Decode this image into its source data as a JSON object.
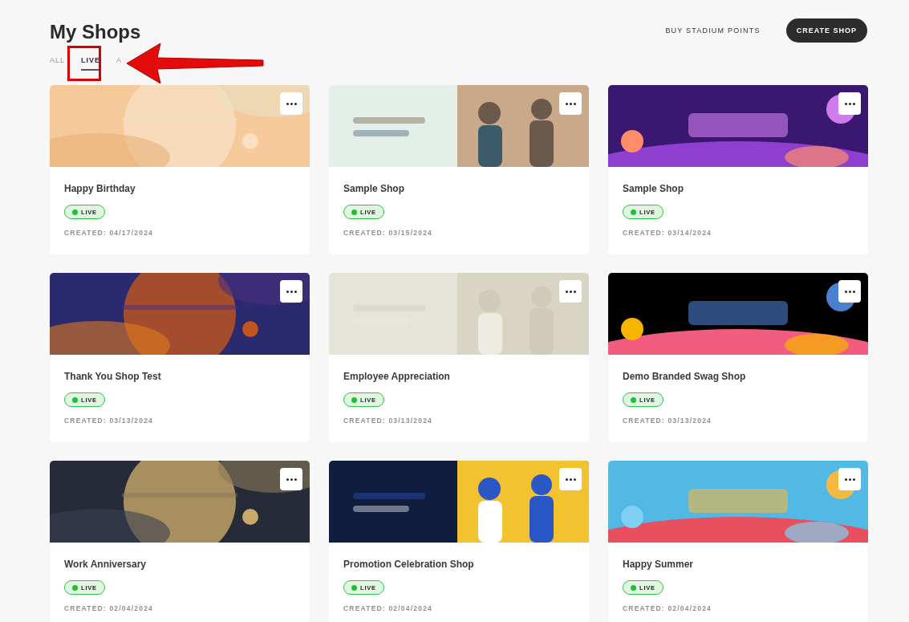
{
  "page": {
    "title": "My Shops"
  },
  "actions": [
    {
      "kind": "link",
      "label": "BUY STADIUM POINTS"
    },
    {
      "kind": "primary",
      "label": "CREATE SHOP"
    }
  ],
  "tabs": [
    {
      "label": "ALL",
      "selected": false
    },
    {
      "label": "LIVE",
      "selected": true
    },
    {
      "label": "A",
      "selected": false
    }
  ],
  "shops": [
    {
      "name": "Happy Birthday",
      "status": "LIVE",
      "created": "CREATED: 04/17/2024"
    },
    {
      "name": "Sample Shop",
      "status": "LIVE",
      "created": "CREATED: 03/15/2024"
    },
    {
      "name": "Sample Shop",
      "status": "LIVE",
      "created": "CREATED: 03/14/2024"
    },
    {
      "name": "Thank You Shop Test",
      "status": "LIVE",
      "created": "CREATED: 03/13/2024"
    },
    {
      "name": "Employee Appreciation",
      "status": "LIVE",
      "created": "CREATED: 03/13/2024"
    },
    {
      "name": "Demo Branded Swag Shop",
      "status": "LIVE",
      "created": "CREATED: 03/13/2024"
    },
    {
      "name": "Work Anniversary",
      "status": "LIVE",
      "created": "CREATED: 02/04/2024"
    },
    {
      "name": "Promotion Celebration Shop",
      "status": "LIVE",
      "created": "CREATED: 02/04/2024"
    },
    {
      "name": "Happy Summer",
      "status": "LIVE",
      "created": "CREATED: 02/04/2024"
    }
  ]
}
